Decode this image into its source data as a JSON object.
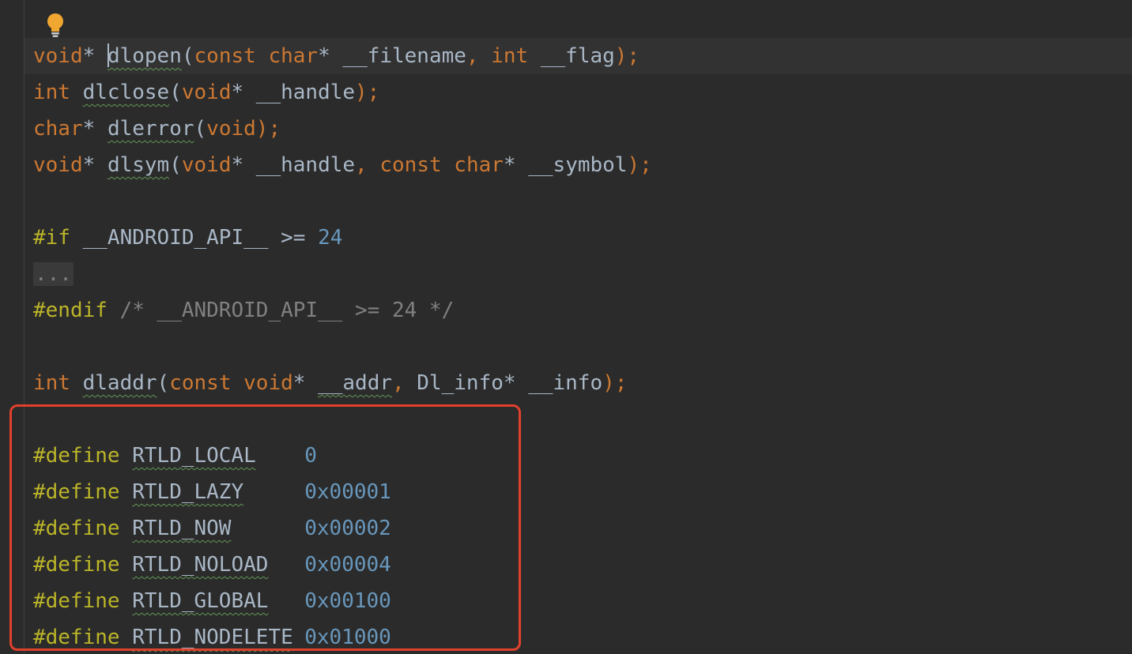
{
  "colors": {
    "background": "#2b2b2b",
    "keyword": "#cc7832",
    "identifier": "#a9b7c6",
    "preprocessor": "#bbb529",
    "number": "#6897bb",
    "comment": "#808080",
    "annotation_box": "#e0412d"
  },
  "icons": {
    "intention": "lightbulb-icon"
  },
  "code": {
    "l1": {
      "type": "void",
      "star": "*",
      "name": "dlopen",
      "open": "(",
      "const": "const",
      "char": "char",
      "p1": "* __filename",
      "comma": ",",
      "int": "int",
      "p2": " __flag",
      "close": ");"
    },
    "l2": {
      "int": "int",
      "name": "dlclose",
      "open": "(",
      "void": "void",
      "p1": "* __handle",
      "close": ");"
    },
    "l3": {
      "char": "char",
      "star": "*",
      "name": "dlerror",
      "open": "(",
      "void": "void",
      "close": ");"
    },
    "l4": {
      "void": "void",
      "star": "*",
      "name": "dlsym",
      "open": "(",
      "void2": "void",
      "p1": "* __handle",
      "comma": ",",
      "const": "const",
      "char": "char",
      "p2": "* __symbol",
      "close": ");"
    },
    "l6": {
      "directive": "#if",
      "macro": "__ANDROID_API__",
      "op": " >= ",
      "num": "24"
    },
    "l7": {
      "fold": "..."
    },
    "l8": {
      "directive": "#endif",
      "comment": "/* __ANDROID_API__ >= 24 */"
    },
    "l10": {
      "int": "int",
      "name": "dladdr",
      "open": "(",
      "const": "const",
      "void": "void",
      "p1": "* ",
      "addr": "__addr",
      "comma": ",",
      "p2": " Dl_info* __info",
      "close": ");"
    }
  },
  "defines": [
    {
      "directive": "#define",
      "name": "RTLD_LOCAL",
      "value": "0"
    },
    {
      "directive": "#define",
      "name": "RTLD_LAZY",
      "value": "0x00001"
    },
    {
      "directive": "#define",
      "name": "RTLD_NOW",
      "value": "0x00002"
    },
    {
      "directive": "#define",
      "name": "RTLD_NOLOAD",
      "value": "0x00004"
    },
    {
      "directive": "#define",
      "name": "RTLD_GLOBAL",
      "value": "0x00100"
    },
    {
      "directive": "#define",
      "name": "RTLD_NODELETE",
      "value": "0x01000"
    }
  ]
}
